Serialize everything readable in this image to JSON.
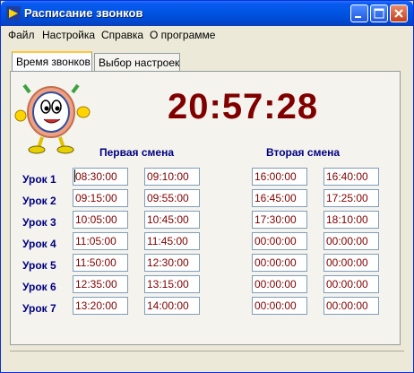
{
  "window": {
    "title": "Расписание звонков"
  },
  "menu": [
    "Файл",
    "Настройка",
    "Справка",
    "О программе"
  ],
  "tabs": [
    "Время звонков",
    "Выбор настроек"
  ],
  "clock": "20:57:28",
  "shifts": {
    "first_title": "Первая смена",
    "second_title": "Вторая смена"
  },
  "lessons": [
    "Урок 1",
    "Урок 2",
    "Урок 3",
    "Урок 4",
    "Урок 5",
    "Урок 6",
    "Урок 7"
  ],
  "times": {
    "first_start": [
      "08:30:00",
      "09:15:00",
      "10:05:00",
      "11:05:00",
      "11:50:00",
      "12:35:00",
      "13:20:00"
    ],
    "first_end": [
      "09:10:00",
      "09:55:00",
      "10:45:00",
      "11:45:00",
      "12:30:00",
      "13:15:00",
      "14:00:00"
    ],
    "second_start": [
      "16:00:00",
      "16:45:00",
      "17:30:00",
      "00:00:00",
      "00:00:00",
      "00:00:00",
      "00:00:00"
    ],
    "second_end": [
      "16:40:00",
      "17:25:00",
      "18:10:00",
      "00:00:00",
      "00:00:00",
      "00:00:00",
      "00:00:00"
    ]
  },
  "colors": {
    "clock": "#800000",
    "labels": "#000080",
    "title_bar": "#0054e3"
  }
}
